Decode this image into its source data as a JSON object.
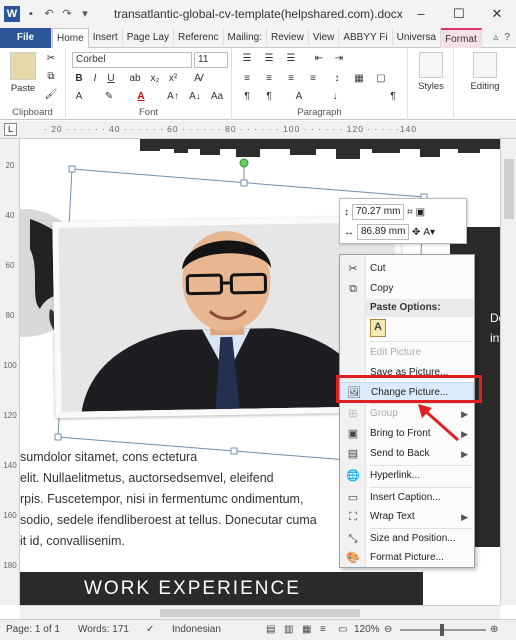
{
  "window": {
    "title": "transatlantic-global-cv-template(helpshared.com).docx",
    "app_icon": "W",
    "controls": [
      "minimize-icon",
      "maximize-icon",
      "close-icon"
    ]
  },
  "tabs": [
    {
      "label": "File"
    },
    {
      "label": "Home"
    },
    {
      "label": "Insert"
    },
    {
      "label": "Page Lay"
    },
    {
      "label": "Referenc"
    },
    {
      "label": "Mailing:"
    },
    {
      "label": "Review"
    },
    {
      "label": "View"
    },
    {
      "label": "ABBYY Fi"
    },
    {
      "label": "Universa"
    },
    {
      "label": "Format"
    }
  ],
  "ribbon": {
    "clipboard_label": "Clipboard",
    "paste_label": "Paste",
    "font_label": "Font",
    "font_name": "Corbel",
    "font_size": "11",
    "paragraph_label": "Paragraph",
    "styles_label": "Styles",
    "editing_label": "Editing",
    "bold": "B",
    "italic": "I",
    "underline": "U",
    "font_color": "A"
  },
  "ruler": {
    "marks": "· 20 · · · · · · 40 · · · · · · 60 · · · · · · 80 · · · · · · 100 · · · · · · 120 · · · · ·140"
  },
  "vruler_marks": [
    "20",
    "40",
    "60",
    "80",
    "100",
    "120",
    "140",
    "160",
    "180"
  ],
  "picture_size": {
    "height": "70.27 mm",
    "width": "86.89 mm"
  },
  "document": {
    "side_text_1": "Don",
    "side_text_2": "invar",
    "body_lines": [
      "sumdolor sitamet, cons ectetura",
      "elit. Nullaelitmetus, auctorsedsemvel, eleifend",
      "rpis. Fuscetempor, nisi in fermentumc ondimentum,",
      "sodio, sedele ifendliberoest at tellus. Donecutar cuma",
      "it id, convallisenim."
    ],
    "section_title": "WORK EXPERIENCE"
  },
  "context_menu": {
    "items": [
      {
        "label": "Cut",
        "icon": "scissors-icon",
        "disabled": false
      },
      {
        "label": "Copy",
        "icon": "copy-icon",
        "disabled": false
      },
      {
        "label": "Paste Options:",
        "header": true
      },
      {
        "label": "Edit Picture",
        "disabled": true
      },
      {
        "label": "Save as Picture...",
        "disabled": false
      },
      {
        "label": "Change Picture...",
        "icon": "change-picture-icon",
        "highlighted": true
      },
      {
        "label": "Group",
        "disabled": true,
        "submenu": true
      },
      {
        "label": "Bring to Front",
        "submenu": true
      },
      {
        "label": "Send to Back",
        "submenu": true
      },
      {
        "label": "Hyperlink...",
        "icon": "hyperlink-icon"
      },
      {
        "label": "Insert Caption...",
        "icon": "caption-icon"
      },
      {
        "label": "Wrap Text",
        "icon": "wrap-text-icon",
        "submenu": true
      },
      {
        "label": "Size and Position...",
        "icon": "size-position-icon"
      },
      {
        "label": "Format Picture...",
        "icon": "format-picture-icon"
      }
    ]
  },
  "status_bar": {
    "page": "Page: 1 of 1",
    "words": "Words: 171",
    "language": "Indonesian",
    "zoom": "120%"
  },
  "colors": {
    "file_tab": "#2b579a",
    "highlight_box": "#e02020",
    "dark_panel": "#2a2a2a"
  }
}
